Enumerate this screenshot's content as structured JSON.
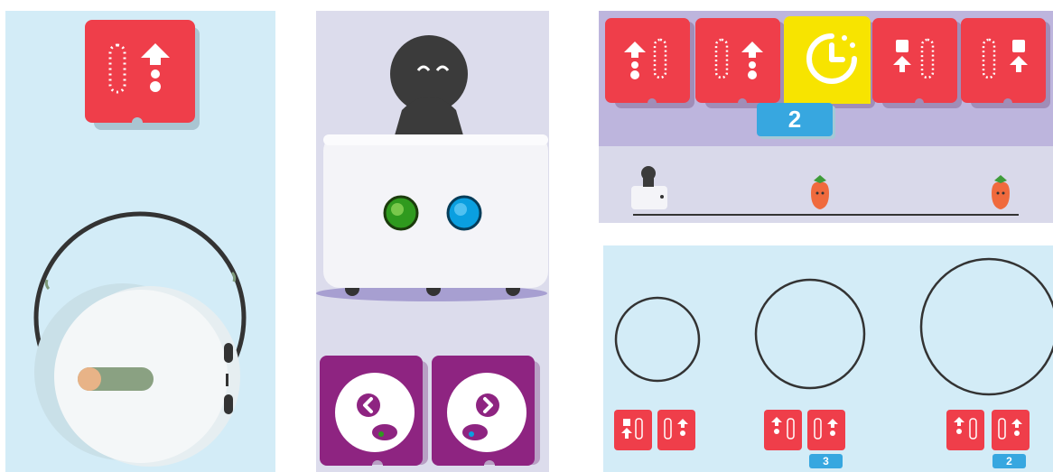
{
  "panels": {
    "rotate_demo": {
      "name": "rotate-demo"
    },
    "robot_view": {
      "name": "robot-view"
    },
    "sequence_timeline": {
      "name": "sequence-timeline"
    },
    "circle_sizes": {
      "name": "circle-sizes"
    }
  },
  "rotate_demo": {
    "card_icon": "rotate-forward-icon"
  },
  "robot_view": {
    "led_left_color": "#2f9a1e",
    "led_right_color": "#0a9fe0",
    "turn_left_icon": "turn-left-icon",
    "turn_right_icon": "turn-right-icon"
  },
  "sequence": {
    "cards": [
      {
        "icon": "forward-rotate-icon"
      },
      {
        "icon": "rotate-forward-icon"
      },
      {
        "icon": "timer-icon",
        "badge": "2"
      },
      {
        "icon": "forward-rotate-icon"
      },
      {
        "icon": "rotate-forward-icon"
      }
    ]
  },
  "circles": {
    "groups": [
      {
        "badge": null
      },
      {
        "badge": "3"
      },
      {
        "badge": "2"
      }
    ]
  },
  "colors": {
    "card_red": "#ef3e4a",
    "card_yellow": "#f7e400",
    "card_purple": "#8e2481",
    "badge_blue": "#37a7e0",
    "sky_bg": "#d3ecf7",
    "lavender_bg": "#dcdcec"
  }
}
